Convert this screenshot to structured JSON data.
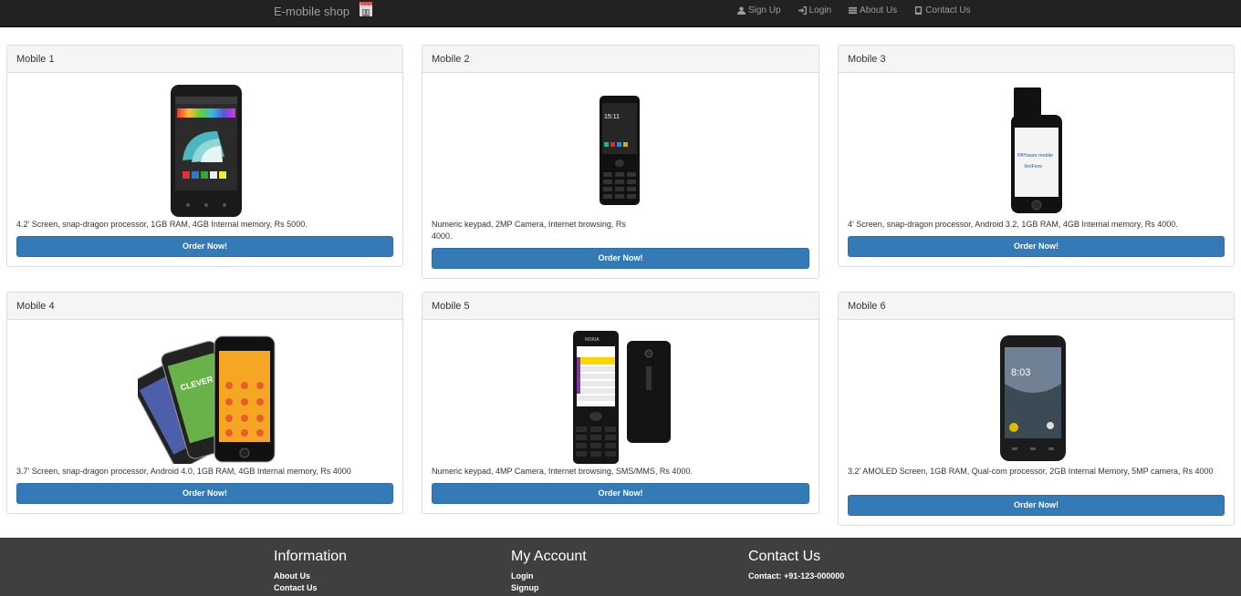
{
  "navbar": {
    "brand": "E-mobile shop",
    "links": [
      {
        "label": "Sign Up",
        "icon": "user-icon"
      },
      {
        "label": "Login",
        "icon": "login-icon"
      },
      {
        "label": "About Us",
        "icon": "list-icon"
      },
      {
        "label": "Contact Us",
        "icon": "phone-icon"
      }
    ]
  },
  "products": [
    {
      "title": "Mobile 1",
      "desc": "4.2' Screen, snap-dragon processor, 1GB RAM, 4GB Internal memory, Rs 5000.",
      "button": "Order Now!"
    },
    {
      "title": "Mobile 2",
      "desc": "Numeric keypad, 2MP Camera, Internet browsing, Rs 4000.",
      "button": "Order Now!"
    },
    {
      "title": "Mobile 3",
      "desc": "4' Screen, snap-dragon processor, Android 3.2, 1GB RAM, 4GB Internal memory, Rs 4000.",
      "button": "Order Now!"
    },
    {
      "title": "Mobile 4",
      "desc": "3.7' Screen, snap-dragon processor, Android 4.0, 1GB RAM, 4GB Internal memory, Rs 4000",
      "button": "Order Now!"
    },
    {
      "title": "Mobile 5",
      "desc": "Numeric keypad, 4MP Camera, Internet browsing, SMS/MMS, Rs 4000.",
      "button": "Order Now!"
    },
    {
      "title": "Mobile 6",
      "desc": "3.2' AMOLED Screen, 1GB RAM, Qual-com processor, 2GB Internal Memory, 5MP camera, Rs 4000",
      "button": "Order Now!"
    }
  ],
  "phone_screens": {
    "mobile2_time": "15:11",
    "mobile3_screen": "PAYware mobile",
    "mobile3_brand": "VeriFone",
    "mobile4_badge": "CLEVER",
    "mobile5_brand": "NOKIA",
    "mobile6_time": "8:03"
  },
  "footer": {
    "information": {
      "title": "Information",
      "items": [
        "About Us",
        "Contact Us"
      ]
    },
    "account": {
      "title": "My Account",
      "items": [
        "Login",
        "Signup"
      ]
    },
    "contact": {
      "title": "Contact Us",
      "items": [
        "Contact: +91-123-000000"
      ]
    }
  },
  "colors": {
    "navbar": "#222222",
    "button": "#337ab7",
    "footer": "#3f3f3f"
  }
}
